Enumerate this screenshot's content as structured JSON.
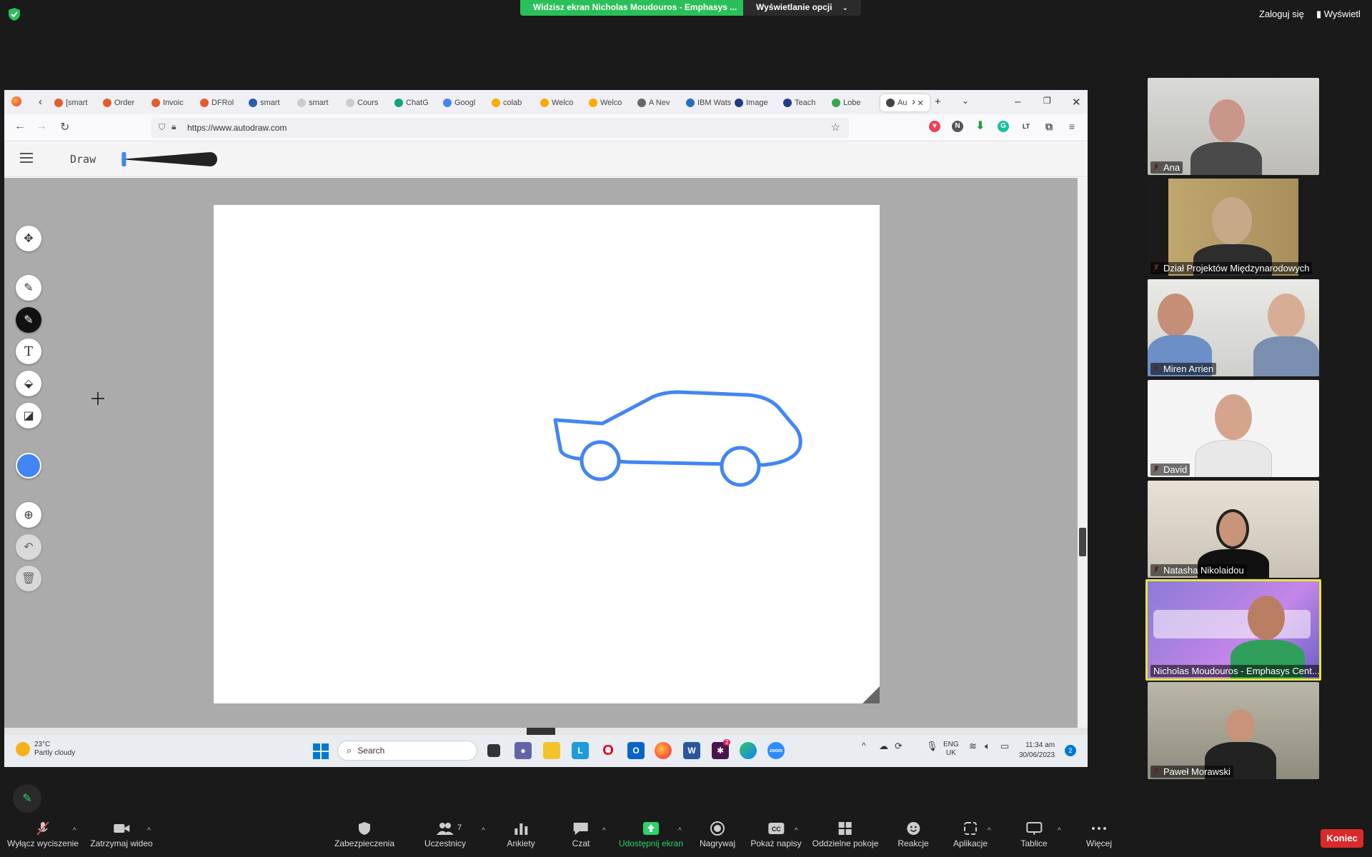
{
  "zoom": {
    "share_banner": "Widzisz ekran Nicholas Moudouros - Emphasys ...",
    "view_options": "Wyświetlanie opcji",
    "login": "Zaloguj się",
    "display": "Wyświetl",
    "end": "Koniec",
    "controls": {
      "mute": "Wyłącz wyciszenie",
      "video": "Zatrzymaj wideo",
      "security": "Zabezpieczenia",
      "participants": "Uczestnicy",
      "participants_count": "7",
      "polls": "Ankiety",
      "chat": "Czat",
      "share": "Udostępnij ekran",
      "record": "Nagrywaj",
      "captions": "Pokaż napisy",
      "breakout": "Oddzielne pokoje",
      "reactions": "Reakcje",
      "apps": "Aplikacje",
      "whiteboards": "Tablice",
      "more": "Więcej"
    },
    "participants": [
      {
        "name": "Ana"
      },
      {
        "name": "Dział Projektów Międzynarodowych"
      },
      {
        "name": "Miren Arrien"
      },
      {
        "name": "David"
      },
      {
        "name": "Natasha Nikolaidou"
      },
      {
        "name": "Nicholas Moudouros - Emphasys Cent..."
      },
      {
        "name": "Paweł Morawski"
      }
    ]
  },
  "browser": {
    "tabs": [
      {
        "label": "[smart",
        "color": "#e55b2c"
      },
      {
        "label": "Order",
        "color": "#e55b2c"
      },
      {
        "label": "Invoic",
        "color": "#e55b2c"
      },
      {
        "label": "DFRol",
        "color": "#e55b2c"
      },
      {
        "label": "smart",
        "color": "#2a5db0"
      },
      {
        "label": "smart",
        "color": "#cccccc"
      },
      {
        "label": "Cours",
        "color": "#cccccc"
      },
      {
        "label": "ChatG",
        "color": "#10a37f"
      },
      {
        "label": "Googl",
        "color": "#4285f4"
      },
      {
        "label": "colab",
        "color": "#f9ab00"
      },
      {
        "label": "Welco",
        "color": "#f9ab00"
      },
      {
        "label": "Welco",
        "color": "#f9ab00"
      },
      {
        "label": "A Nev",
        "color": "#666666"
      },
      {
        "label": "IBM Wats",
        "color": "#1f70c1"
      },
      {
        "label": "Image",
        "color": "#1f3c88"
      },
      {
        "label": "Teach",
        "color": "#1f3c88"
      },
      {
        "label": "Lobe",
        "color": "#34a853"
      },
      {
        "label": "Au",
        "color": "#444444"
      }
    ],
    "new_tab": "+",
    "url": "https://www.autodraw.com",
    "ext_letter": "N"
  },
  "autodraw": {
    "mode_label": "Draw",
    "stroke_color": "#4285f4",
    "stroke_size_fraction": 0.02
  },
  "taskbar": {
    "temp": "23°C",
    "weather": "Partly cloudy",
    "search": "Search",
    "lang1": "ENG",
    "lang2": "UK",
    "time": "11:34 am",
    "date": "30/06/2023",
    "notifications": "2",
    "badge": "2"
  }
}
